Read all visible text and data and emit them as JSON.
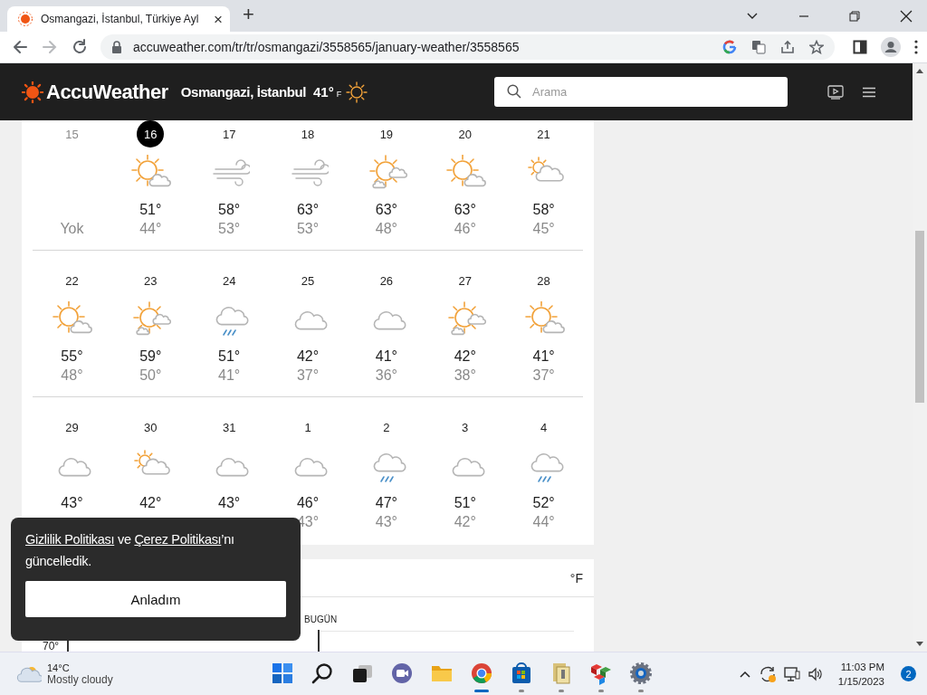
{
  "browser": {
    "tab": {
      "title": "Osmangazi, İstanbul, Türkiye Ayl",
      "close": "×"
    },
    "new_tab": "+",
    "url": "accuweather.com/tr/tr/osmangazi/3558565/january-weather/3558565"
  },
  "header": {
    "brand": "AccuWeather",
    "location": "Osmangazi, İstanbul",
    "temp": "41°",
    "unit": "F",
    "search": {
      "placeholder": "Arama"
    }
  },
  "calendar": {
    "weeks": [
      {
        "days": [
          {
            "date": "15",
            "selected": false,
            "past": true,
            "low": "Yok"
          },
          {
            "date": "16",
            "selected": true,
            "past": false,
            "kind": "sun-cloud",
            "high": "51°",
            "low": "44°"
          },
          {
            "date": "17",
            "selected": false,
            "past": false,
            "kind": "wind",
            "high": "58°",
            "low": "53°"
          },
          {
            "date": "18",
            "selected": false,
            "past": false,
            "kind": "wind",
            "high": "63°",
            "low": "53°"
          },
          {
            "date": "19",
            "selected": false,
            "past": false,
            "kind": "sun-clouds",
            "high": "63°",
            "low": "48°"
          },
          {
            "date": "20",
            "selected": false,
            "past": false,
            "kind": "sun-cloud",
            "high": "63°",
            "low": "46°"
          },
          {
            "date": "21",
            "selected": false,
            "past": false,
            "kind": "cloud-sun",
            "high": "58°",
            "low": "45°"
          }
        ]
      },
      {
        "days": [
          {
            "date": "22",
            "selected": false,
            "past": false,
            "kind": "sun-cloud",
            "high": "55°",
            "low": "48°"
          },
          {
            "date": "23",
            "selected": false,
            "past": false,
            "kind": "sun-clouds",
            "high": "59°",
            "low": "50°"
          },
          {
            "date": "24",
            "selected": false,
            "past": false,
            "kind": "rain",
            "high": "51°",
            "low": "41°"
          },
          {
            "date": "25",
            "selected": false,
            "past": false,
            "kind": "cloud",
            "high": "42°",
            "low": "37°"
          },
          {
            "date": "26",
            "selected": false,
            "past": false,
            "kind": "cloud",
            "high": "41°",
            "low": "36°"
          },
          {
            "date": "27",
            "selected": false,
            "past": false,
            "kind": "sun-clouds",
            "high": "42°",
            "low": "38°"
          },
          {
            "date": "28",
            "selected": false,
            "past": false,
            "kind": "sun-cloud",
            "high": "41°",
            "low": "37°"
          }
        ]
      },
      {
        "days": [
          {
            "date": "29",
            "selected": false,
            "past": false,
            "kind": "cloud",
            "high": "43°"
          },
          {
            "date": "30",
            "selected": false,
            "past": false,
            "kind": "cloud-sun",
            "high": "42°"
          },
          {
            "date": "31",
            "selected": false,
            "past": false,
            "kind": "cloud",
            "high": "43°"
          },
          {
            "date": "1",
            "selected": false,
            "past": false,
            "kind": "cloud",
            "high": "46°",
            "low": "43°"
          },
          {
            "date": "2",
            "selected": false,
            "past": false,
            "kind": "rain",
            "high": "47°",
            "low": "43°"
          },
          {
            "date": "3",
            "selected": false,
            "past": false,
            "kind": "cloud",
            "high": "51°",
            "low": "42°"
          },
          {
            "date": "4",
            "selected": false,
            "past": false,
            "kind": "rain",
            "high": "52°",
            "low": "44°"
          }
        ]
      }
    ]
  },
  "graph": {
    "unit": "°F",
    "today_label": "BUGÜN",
    "y_label": "70°"
  },
  "cookie_notice": {
    "message": [
      {
        "text": "Gizlilik Politikası",
        "link": true
      },
      {
        "text": " ve ",
        "link": false
      },
      {
        "text": "Çerez Politikası",
        "link": true
      },
      {
        "text": "’nı güncelledik.",
        "link": false
      }
    ],
    "button": "Anladım"
  },
  "taskbar": {
    "weather": {
      "temp": "14°C",
      "condition": "Mostly cloudy"
    },
    "apps": [
      {
        "kind": "start",
        "selected": false,
        "running": false
      },
      {
        "kind": "search",
        "selected": false,
        "running": false
      },
      {
        "kind": "taskview",
        "selected": false,
        "running": false
      },
      {
        "kind": "chat",
        "selected": false,
        "running": false
      },
      {
        "kind": "folder",
        "selected": false,
        "running": false
      },
      {
        "kind": "browser",
        "selected": true,
        "running": true
      },
      {
        "kind": "store",
        "selected": false,
        "running": true
      },
      {
        "kind": "archive",
        "selected": false,
        "running": true
      },
      {
        "kind": "cubes",
        "selected": false,
        "running": true
      },
      {
        "kind": "settings",
        "selected": false,
        "running": true
      }
    ],
    "time": "11:03 PM",
    "date": "1/15/2023",
    "notifications": "2"
  }
}
